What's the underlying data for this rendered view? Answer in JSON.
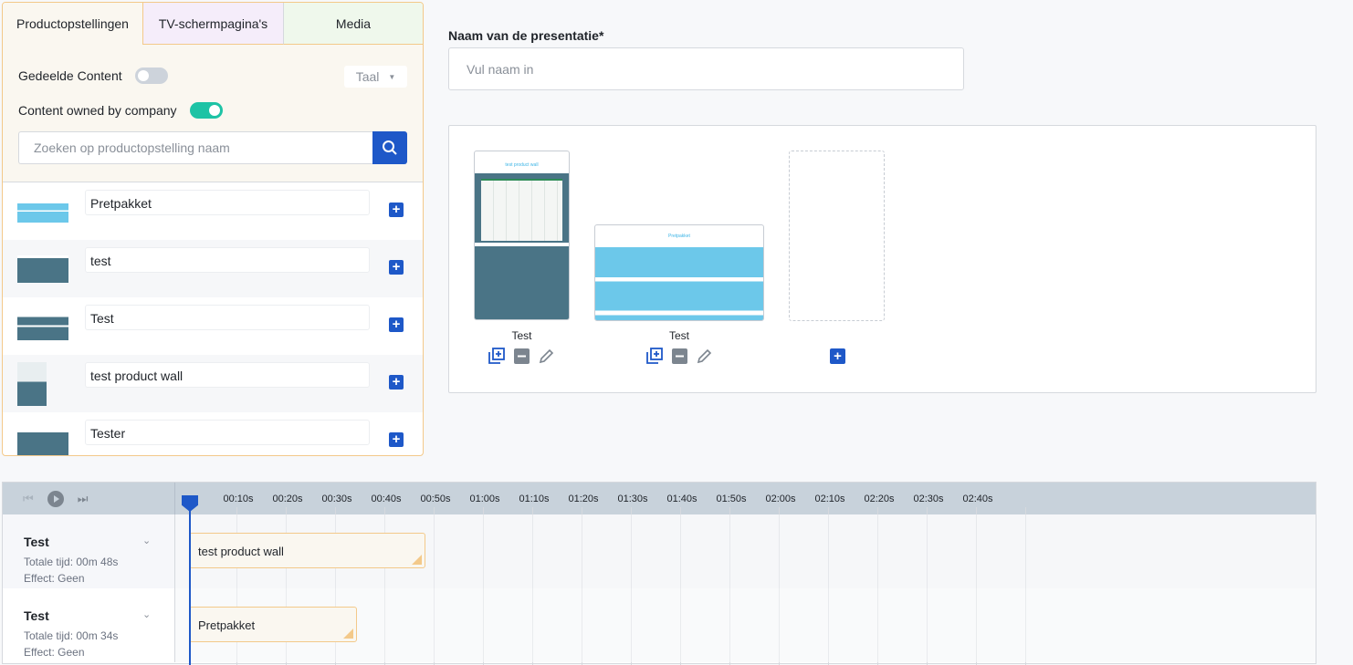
{
  "sidebar": {
    "tabs": [
      "Productopstellingen",
      "TV-schermpagina's",
      "Media"
    ],
    "shared_label": "Gedeelde Content",
    "shared_on": false,
    "owned_label": "Content owned by company",
    "owned_on": true,
    "language": "Taal",
    "search_placeholder": "Zoeken op productopstelling naam",
    "items": [
      {
        "name": "Pretpakket"
      },
      {
        "name": "test"
      },
      {
        "name": "Test"
      },
      {
        "name": "test product wall"
      },
      {
        "name": "Tester"
      }
    ]
  },
  "form": {
    "name_label": "Naam van de presentatie*",
    "name_placeholder": "Vul naam in",
    "name_value": ""
  },
  "slides": [
    {
      "title": "test product wall",
      "caption": "Test"
    },
    {
      "title": "Pretpakket",
      "caption": "Test"
    }
  ],
  "timeline": {
    "ticks": [
      "00:10s",
      "00:20s",
      "00:30s",
      "00:40s",
      "00:50s",
      "01:00s",
      "01:10s",
      "01:20s",
      "01:30s",
      "01:40s",
      "01:50s",
      "02:00s",
      "02:10s",
      "02:20s",
      "02:30s",
      "02:40s"
    ],
    "tracks": [
      {
        "title": "Test",
        "total": "Totale tijd: 00m 48s",
        "effect": "Effect: Geen",
        "clip": "test product wall",
        "duration_s": 48
      },
      {
        "title": "Test",
        "total": "Totale tijd: 00m 34s",
        "effect": "Effect: Geen",
        "clip": "Pretpakket",
        "duration_s": 34
      }
    ]
  },
  "colors": {
    "accent": "#1e58c8",
    "toggle_on": "#1dc3a5",
    "panel_border": "#f3c98a"
  }
}
